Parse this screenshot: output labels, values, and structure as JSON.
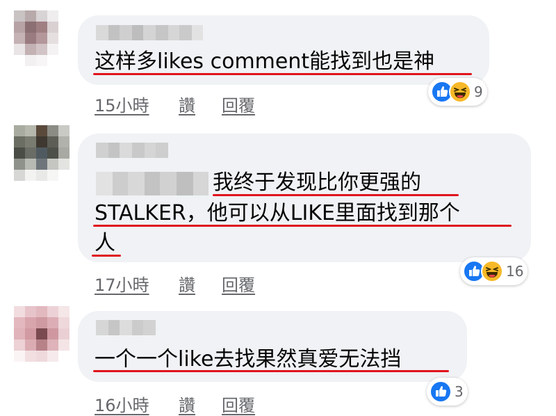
{
  "comments": [
    {
      "lines": [
        "这样多likes comment能找到也是神"
      ],
      "time": "15小時",
      "like_label": "讚",
      "reply_label": "回覆",
      "reactions": [
        "like-icon",
        "haha-icon"
      ],
      "reaction_count": "9"
    },
    {
      "lines": [
        "我终于发现比你更强的",
        "STALKER，他可以从LIKE里面找到那个",
        "人"
      ],
      "time": "17小時",
      "like_label": "讚",
      "reply_label": "回覆",
      "reactions": [
        "like-icon",
        "haha-icon"
      ],
      "reaction_count": "16"
    },
    {
      "lines": [
        "一个一个like去找果然真爱无法挡"
      ],
      "time": "16小時",
      "like_label": "讚",
      "reply_label": "回覆",
      "reactions": [
        "like-icon"
      ],
      "reaction_count": "3"
    }
  ],
  "colors": {
    "bubble": "#f0f2f5",
    "underline": "#e0141d",
    "like_blue": "#1877f2",
    "haha_yellow": "#f7b928",
    "meta_text": "#65676b"
  }
}
